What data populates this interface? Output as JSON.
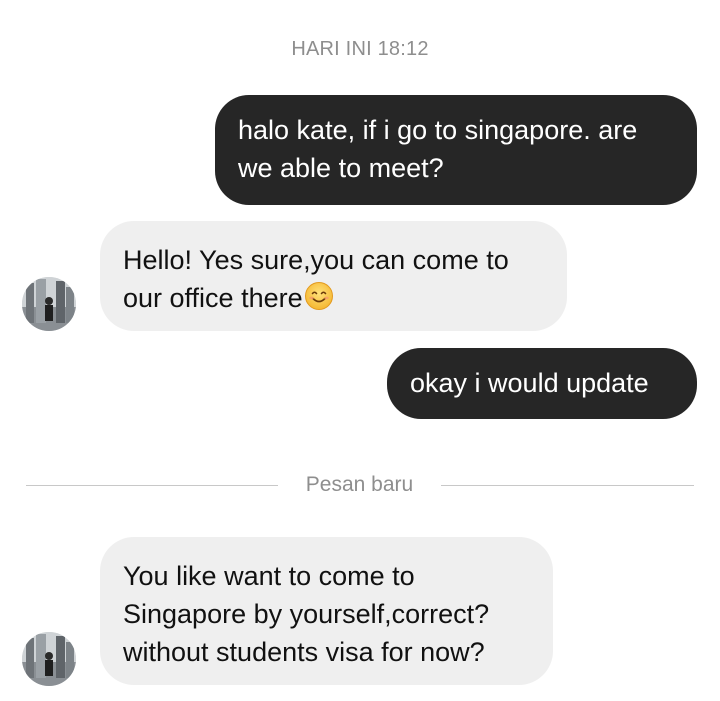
{
  "conversation": {
    "timestamp": "HARI INI 18:12",
    "new_messages_divider": "Pesan baru",
    "messages": [
      {
        "direction": "outgoing",
        "text": "halo kate, if i go to singapore. are\nwe able to meet?"
      },
      {
        "direction": "incoming",
        "text": "Hello! Yes sure,you can come to\nour office there",
        "emoji": "smiling-face-icon"
      },
      {
        "direction": "outgoing",
        "text": "okay i would update"
      },
      {
        "direction": "incoming",
        "text": "You like want to come to\nSingapore by yourself,correct?\nwithout students visa for now?"
      }
    ]
  },
  "colors": {
    "outgoing_bubble": "#262626",
    "incoming_bubble": "#efefef",
    "meta_text": "#8e8e8e"
  }
}
